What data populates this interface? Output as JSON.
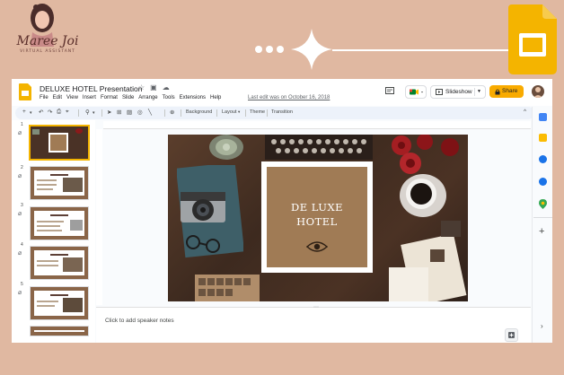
{
  "brand": {
    "name": "Maree Joi",
    "tagline": "VIRTUAL ASSISTANT"
  },
  "colors": {
    "background": "#e0b8a1",
    "accent_yellow": "#f9ab00",
    "slide_card": "#a07b55",
    "slides_logo": "#f4b400"
  },
  "app": {
    "title": "DELUXE HOTEL Presentation",
    "menu": [
      "File",
      "Edit",
      "View",
      "Insert",
      "Format",
      "Slide",
      "Arrange",
      "Tools",
      "Extensions",
      "Help"
    ],
    "last_edit": "Last edit was on October 16, 2018",
    "slideshow_label": "Slideshow",
    "share_label": "Share"
  },
  "toolbar": {
    "background": "Background",
    "layout": "Layout",
    "theme": "Theme",
    "transition": "Transition"
  },
  "filmstrip": {
    "slides": [
      "1",
      "2",
      "3",
      "4",
      "5"
    ]
  },
  "slide": {
    "title_line1": "DE LUXE",
    "title_line2": "HOTEL"
  },
  "notes": {
    "placeholder": "Click to add speaker notes"
  },
  "icons": {
    "sparkle": "sparkle-icon",
    "eye": "eye-icon",
    "app": "google-slides-icon"
  }
}
